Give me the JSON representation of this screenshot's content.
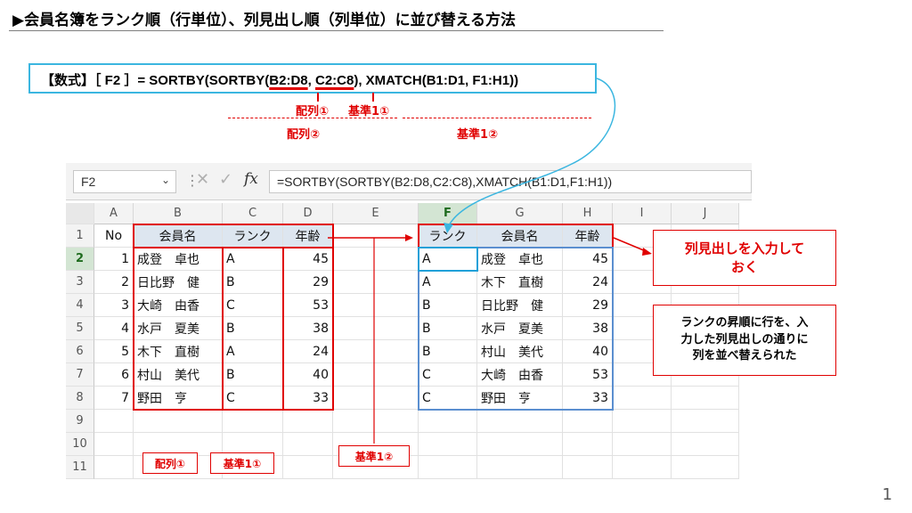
{
  "title": "▶会員名簿をランク順（行単位）、列見出し順（列単位）に並び替える方法",
  "formula": {
    "prefix": "【数式】［ F2 ］= SORTBY(SORTBY(",
    "arg1": "B2:D8",
    "mid1": ", ",
    "arg2": "C2:C8",
    "suffix": "), XMATCH(B1:D1, F1:H1))"
  },
  "labels": {
    "array1": "配列①",
    "key1": "基準1①",
    "array2": "配列②",
    "key2": "基準1②"
  },
  "formula_bar": {
    "name_box": "F2",
    "fx": "fx",
    "formula": "=SORTBY(SORTBY(B2:D8,C2:C8),XMATCH(B1:D1,F1:H1))"
  },
  "columns": [
    "A",
    "B",
    "C",
    "D",
    "E",
    "F",
    "G",
    "H",
    "I",
    "J"
  ],
  "rows": [
    "1",
    "2",
    "3",
    "4",
    "5",
    "6",
    "7",
    "8",
    "9",
    "10",
    "11"
  ],
  "source_table": {
    "headers": [
      "No",
      "会員名",
      "ランク",
      "年齢"
    ],
    "rows": [
      [
        "1",
        "成登　卓也",
        "A",
        "45"
      ],
      [
        "2",
        "日比野　健",
        "B",
        "29"
      ],
      [
        "3",
        "大崎　由香",
        "C",
        "53"
      ],
      [
        "4",
        "水戸　夏美",
        "B",
        "38"
      ],
      [
        "5",
        "木下　直樹",
        "A",
        "24"
      ],
      [
        "6",
        "村山　美代",
        "B",
        "40"
      ],
      [
        "7",
        "野田　亨",
        "C",
        "33"
      ]
    ]
  },
  "result_table": {
    "headers": [
      "ランク",
      "会員名",
      "年齢"
    ],
    "rows": [
      [
        "A",
        "成登　卓也",
        "45"
      ],
      [
        "A",
        "木下　直樹",
        "24"
      ],
      [
        "B",
        "日比野　健",
        "29"
      ],
      [
        "B",
        "水戸　夏美",
        "38"
      ],
      [
        "B",
        "村山　美代",
        "40"
      ],
      [
        "C",
        "大崎　由香",
        "53"
      ],
      [
        "C",
        "野田　亨",
        "33"
      ]
    ]
  },
  "callouts": {
    "input_header": "列見出しを入力して\nおく",
    "result_note": "ランクの昇順に行を、入\n力した列見出しの通りに\n列を並べ替えられた"
  },
  "page_number": "1",
  "colors": {
    "accent_red": "#e00000",
    "accent_blue": "#3bb6e0"
  }
}
